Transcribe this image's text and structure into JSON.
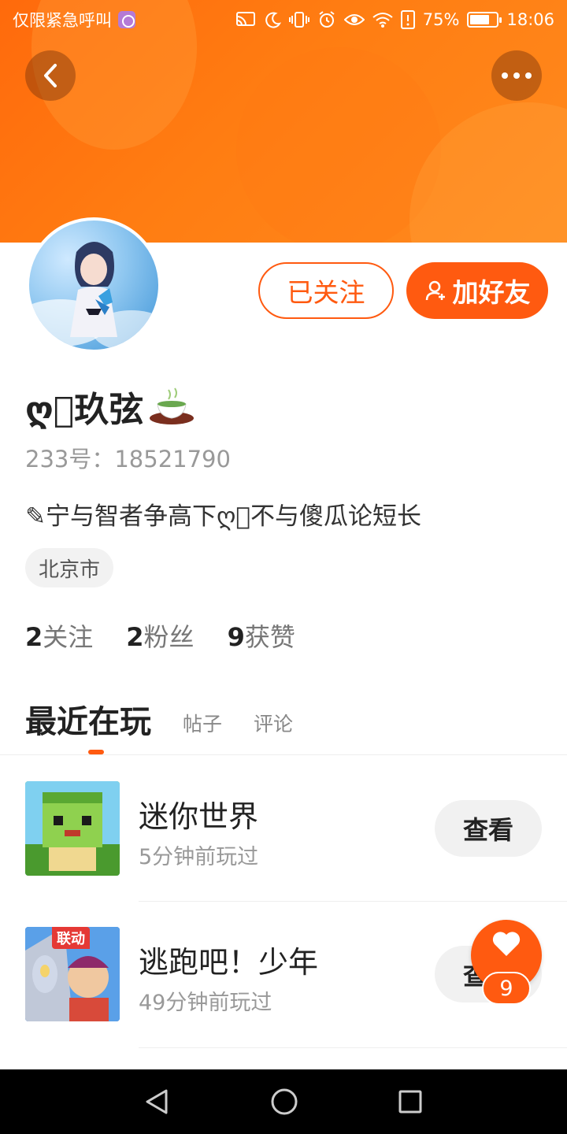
{
  "status_bar": {
    "carrier_text": "仅限紧急呼叫",
    "battery_percent": "75%",
    "battery_level": 0.75,
    "time": "18:06",
    "icons": [
      "cast-icon",
      "moon-icon",
      "vibrate-icon",
      "alarm-icon",
      "eye-icon",
      "wifi-icon",
      "alert-icon",
      "battery-icon"
    ]
  },
  "header": {
    "back_icon": "chevron-left-icon",
    "more_icon": "more-dots-icon"
  },
  "profile": {
    "follow_button_label": "已关注",
    "add_friend_label": "加好友",
    "nickname": "ღ⃢玖弦",
    "uid": "233号：18521790",
    "bio": "✎宁与智者争高下ღ⃢不与傻瓜论短长",
    "location": "北京市",
    "stats": [
      {
        "num": "2",
        "label": "关注"
      },
      {
        "num": "2",
        "label": "粉丝"
      },
      {
        "num": "9",
        "label": "获赞"
      }
    ]
  },
  "tabs": [
    {
      "label": "最近在玩",
      "active": true
    },
    {
      "label": "帖子",
      "active": false
    },
    {
      "label": "评论",
      "active": false
    }
  ],
  "games": [
    {
      "title": "迷你世界",
      "subtitle": "5分钟前玩过",
      "button": "查看"
    },
    {
      "title": "逃跑吧！少年",
      "subtitle": "49分钟前玩过",
      "button": "查看",
      "badge": "联动"
    }
  ],
  "floating_like": {
    "count": "9",
    "icon": "heart-icon"
  },
  "colors": {
    "accent": "#ff5a10",
    "banner": "#ff7d12"
  }
}
